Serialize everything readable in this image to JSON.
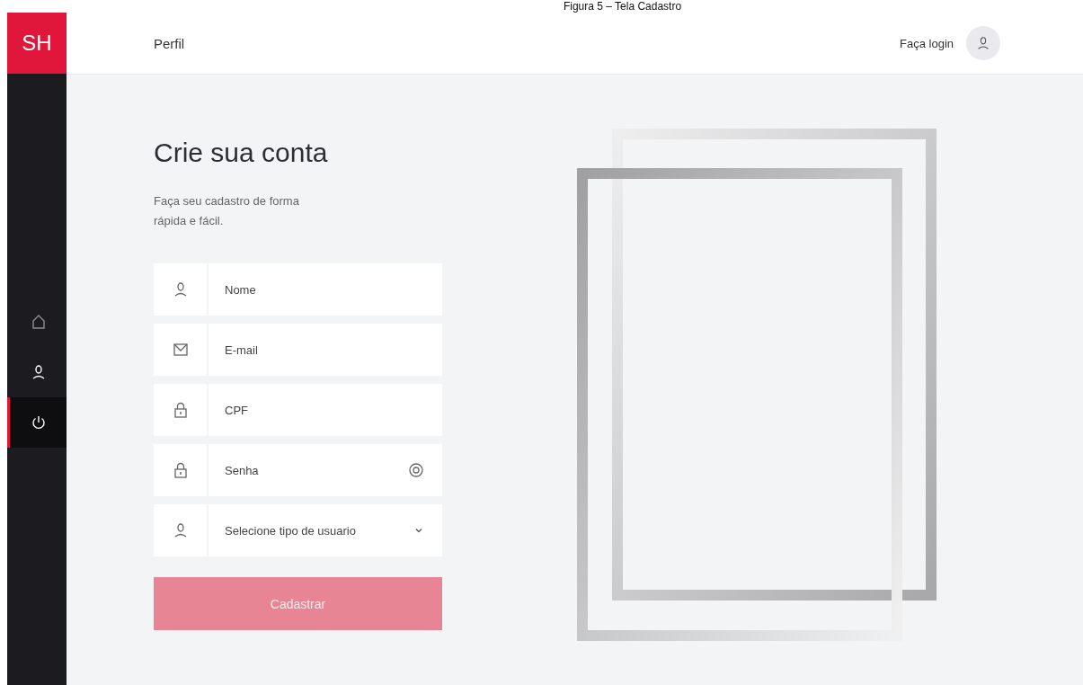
{
  "caption": "Figura 5 – Tela Cadastro",
  "logo": "SH",
  "header": {
    "title": "Perfil",
    "login_link": "Faça login"
  },
  "sidebar": {
    "items": [
      {
        "selected": false
      },
      {
        "selected": false
      },
      {
        "selected": true
      }
    ]
  },
  "form": {
    "title": "Crie sua conta",
    "subtitle": "Faça seu cadastro de forma rápida e fácil.",
    "fields": [
      {
        "kind": "text",
        "placeholder": "Nome"
      },
      {
        "kind": "text",
        "placeholder": "E-mail"
      },
      {
        "kind": "text",
        "placeholder": "CPF"
      },
      {
        "kind": "password",
        "placeholder": "Senha"
      },
      {
        "kind": "select",
        "placeholder": "Selecione tipo de usuario"
      }
    ],
    "submit": {
      "label": "Cadastrar",
      "disabled": true
    }
  }
}
